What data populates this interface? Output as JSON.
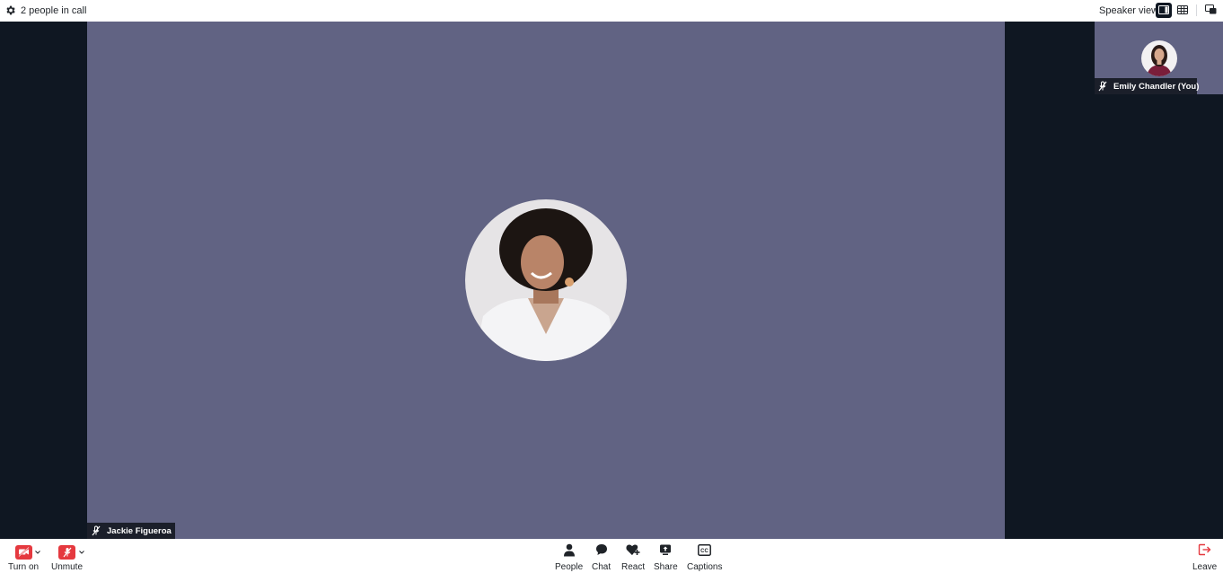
{
  "topbar": {
    "people_count": "2 people in call",
    "view_label": "Speaker view",
    "icons": [
      "gear-icon",
      "speaker-view-icon",
      "grid-view-icon",
      "popout-icon"
    ]
  },
  "main_participant": {
    "name": "Jackie Figueroa",
    "mic_state": "muted"
  },
  "self_participant": {
    "name": "Emily Chandler (You)",
    "mic_state": "muted"
  },
  "controls": {
    "camera_label": "Turn on",
    "mic_label": "Unmute",
    "people_label": "People",
    "chat_label": "Chat",
    "react_label": "React",
    "share_label": "Share",
    "captions_label": "Captions",
    "leave_label": "Leave"
  },
  "colors": {
    "stage_bg": "#0f1722",
    "tile_bg": "#616383",
    "alert_red": "#e5393f",
    "name_tag_bg": "#1b1f2a"
  }
}
